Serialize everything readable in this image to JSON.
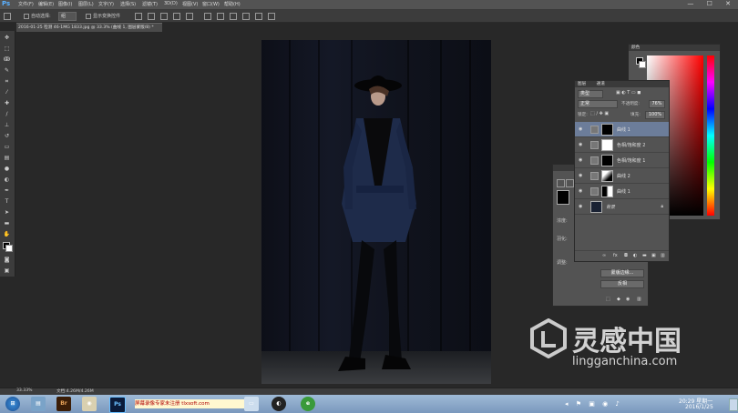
{
  "app": {
    "logo": "Ps"
  },
  "menu": [
    "文件(F)",
    "编辑(E)",
    "图像(I)",
    "图层(L)",
    "文字(Y)",
    "选择(S)",
    "滤镜(T)",
    "3D(D)",
    "视图(V)",
    "窗口(W)",
    "帮助(H)"
  ],
  "window_controls": "— ☐ ✕",
  "options_bar": {
    "auto_select_label": "自动选择:",
    "auto_select_value": "组",
    "show_transform_label": "显示变换控件"
  },
  "document_tab": "2016-01-25 检测 46-1MG 1833.jpg @ 33.3% (曲线 1, 图层蒙版/8) *",
  "status_bar": {
    "zoom": "33.33%",
    "doc_size": "文档:4.26M/4.26M"
  },
  "color_panel": {
    "title": "颜色"
  },
  "layers_panel": {
    "tabs": [
      "图层",
      "通道"
    ],
    "kind_label": "类型",
    "blend_mode": "正常",
    "opacity_label": "不透明度:",
    "opacity_value": "76%",
    "lock_label": "锁定:",
    "fill_label": "填充:",
    "fill_value": "100%",
    "layers": [
      {
        "name": "曲线 1"
      },
      {
        "name": "色相/饱和度 2"
      },
      {
        "name": "色相/饱和度 1"
      },
      {
        "name": "曲线 2"
      },
      {
        "name": "曲线 1"
      },
      {
        "name": "背景"
      }
    ]
  },
  "properties_panel": {
    "density_label": "浓度:",
    "feather_label": "羽化:",
    "refine_label": "调整:",
    "btn_mask_edge": "蒙版边缘...",
    "btn_invert": "反相"
  },
  "taskbar": {
    "time": "20:29 星期一",
    "date": "2016/1/25",
    "apps": [
      "Br",
      "Ps"
    ],
    "recorder_text": "屏幕录像专家未注册 tlxsoft.com"
  },
  "watermark": {
    "brand": "灵感中国",
    "url": "lingganchina.com"
  }
}
